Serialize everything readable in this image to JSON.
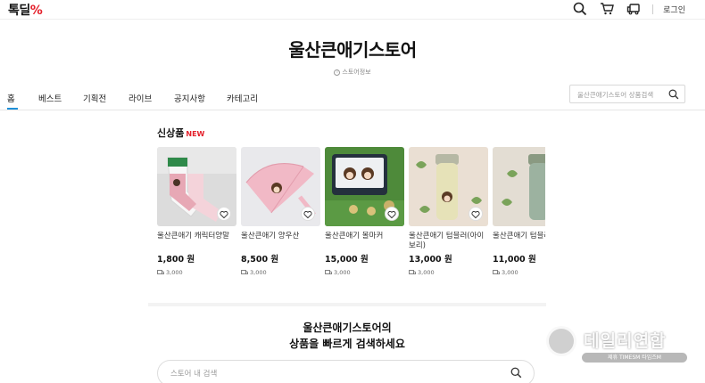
{
  "header": {
    "logo_text": "톡딜",
    "logo_mark": "%",
    "login_label": "로그인",
    "icons": [
      "search-icon",
      "cart-icon",
      "delivery-truck-icon"
    ]
  },
  "store": {
    "title": "울산큰애기스토어",
    "info_label": "스토어정보"
  },
  "nav": {
    "items": [
      "홈",
      "베스트",
      "기획전",
      "라이브",
      "공지사항",
      "카테고리"
    ],
    "active": "홈",
    "search_placeholder": "울산큰애기스토어 상품검색"
  },
  "new_products": {
    "title": "신상품",
    "badge": "NEW",
    "items": [
      {
        "name": "울산큰애기 캐릭터양말",
        "price": "1,800 원",
        "shipping": "3,000"
      },
      {
        "name": "울산큰애기 양우산",
        "price": "8,500 원",
        "shipping": "3,000"
      },
      {
        "name": "울산큰애기 볼마커",
        "price": "15,000 원",
        "shipping": "3,000"
      },
      {
        "name": "울산큰애기 텀블러(아이보리)",
        "price": "13,000 원",
        "shipping": "3,000"
      },
      {
        "name": "울산큰애기 텀블러(그린)",
        "price": "11,000 원",
        "shipping": "3,000"
      }
    ]
  },
  "search_prompt": {
    "line1": "울산큰애기스토어의",
    "line2": "상품을 빠르게 검색하세요",
    "placeholder": "스토어 내 검색"
  },
  "watermark": {
    "title": "데일리연합",
    "subtitle": "제휴 TIMESM 타임즈M"
  },
  "colors": {
    "accent_red": "#e4202b",
    "active_tab": "#1e90d8"
  }
}
